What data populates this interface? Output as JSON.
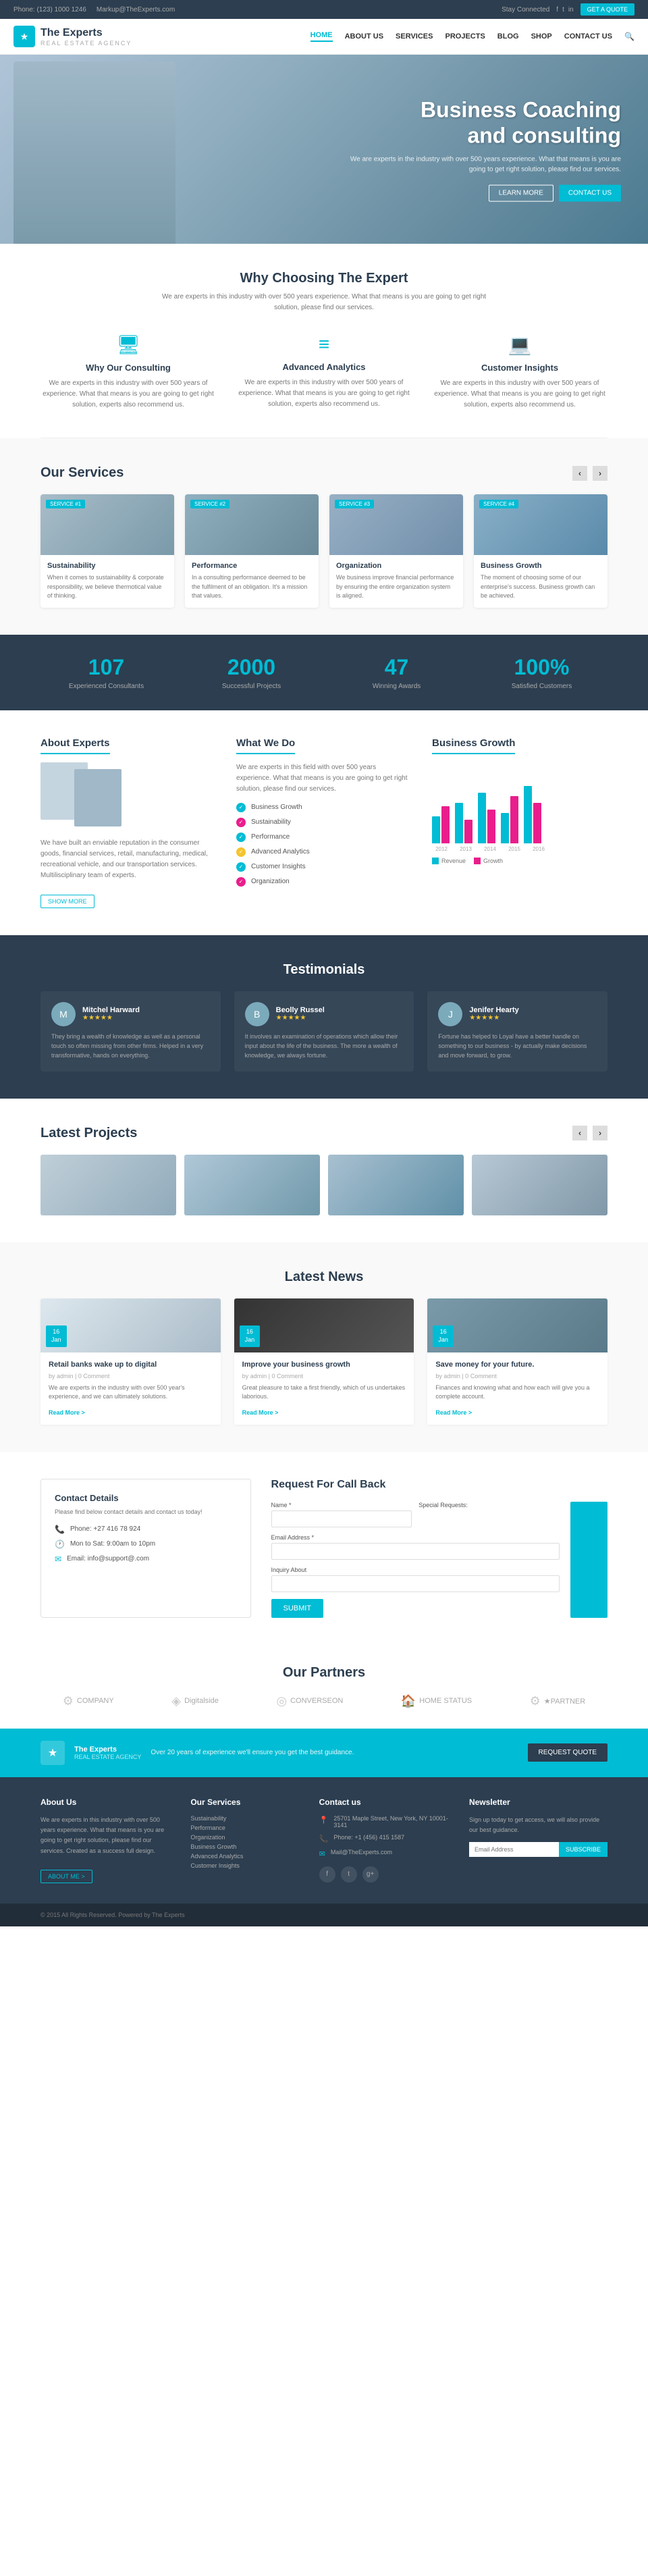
{
  "topbar": {
    "phone": "Phone: (123) 1000 1246",
    "email": "Markup@TheExperts.com",
    "connected": "Stay Connected",
    "btn_quote": "GET A QUOTE",
    "social": [
      "f",
      "t",
      "in"
    ]
  },
  "header": {
    "logo_text": "The Experts",
    "logo_sub": "REAL ESTATE AGENCY",
    "nav": [
      "HOME",
      "ABOUT US",
      "SERVICES",
      "PROJECTS",
      "BLOG",
      "SHOP",
      "CONTACT US"
    ],
    "nav_active": "HOME"
  },
  "hero": {
    "title": "Business Coaching\nand consulting",
    "subtitle": "We are experts in the industry with over 500 years experience. What that means is you are going to get right solution, please find our services.",
    "btn1": "LEARN MORE",
    "btn2": "CONTACT US"
  },
  "why": {
    "title": "Why Choosing The Expert",
    "subtitle": "We are experts in this industry with over 500 years experience. What that means is you are going to get right solution, please find our services.",
    "items": [
      {
        "icon": "🖥",
        "title": "Why Our Consulting",
        "text": "We are experts in this industry with over 500 years of experience. What that means is you are going to get right solution, experts also recommend us."
      },
      {
        "icon": "≡",
        "title": "Advanced Analytics",
        "text": "We are experts in this industry with over 500 years of experience. What that means is you are going to get right solution, experts also recommend us."
      },
      {
        "icon": "💻",
        "title": "Customer Insights",
        "text": "We are experts in this industry with over 500 years of experience. What that means is you are going to get right solution, experts also recommend us."
      }
    ]
  },
  "services": {
    "title": "Our Services",
    "items": [
      {
        "badge": "SERVICE #1",
        "name": "Sustainability",
        "desc": "When it comes to sustainability & corporate responsibility, we believe thermotical value of thinking."
      },
      {
        "badge": "SERVICE #2",
        "name": "Performance",
        "desc": "In a consulting performance deemed to be the fulfilment of an obligation. It's a mission that values."
      },
      {
        "badge": "SERVICE #3",
        "name": "Organization",
        "desc": "We business improve financial performance by ensuring the entire organization system is aligned."
      },
      {
        "badge": "SERVICE #4",
        "name": "Business Growth",
        "desc": "The moment of choosing some of our enterprise's success. Business growth can be achieved."
      }
    ]
  },
  "stats": [
    {
      "num": "107",
      "label": "Experienced Consultants"
    },
    {
      "num": "2000",
      "label": "Successful Projects"
    },
    {
      "num": "47",
      "label": "Winning Awards"
    },
    {
      "num": "100%",
      "label": "Satisfied Customers"
    }
  ],
  "about": {
    "title": "About Experts",
    "text": "We have built an enviable reputation in the consumer goods, financial services, retail, manufacturing, medical, recreational vehicle, and our transportation services. Multilisciplinary team of experts.",
    "link": "SHOW MORE"
  },
  "whatwedo": {
    "title": "What We Do",
    "intro": "We are experts in this field with over 500 years experience. What that means is you are going to get right solution, please find our services.",
    "items": [
      {
        "label": "Business Growth",
        "color": "#00bcd4"
      },
      {
        "label": "Sustainability",
        "color": "#e91e8c"
      },
      {
        "label": "Performance",
        "color": "#00bcd4"
      },
      {
        "label": "Advanced Analytics",
        "color": "#f4c430"
      },
      {
        "label": "Customer Insights",
        "color": "#00bcd4"
      },
      {
        "label": "Organization",
        "color": "#e91e8c"
      }
    ]
  },
  "chart": {
    "title": "Business Growth",
    "groups": [
      {
        "label": "2012",
        "cyan": 40,
        "pink": 55
      },
      {
        "label": "2013",
        "cyan": 60,
        "pink": 35
      },
      {
        "label": "2014",
        "cyan": 75,
        "pink": 50
      },
      {
        "label": "2015",
        "cyan": 45,
        "pink": 70
      },
      {
        "label": "2016",
        "cyan": 85,
        "pink": 60
      }
    ]
  },
  "testimonials": {
    "title": "Testimonials",
    "items": [
      {
        "name": "Mitchel Harward",
        "stars": "★★★★★",
        "text": "They bring a wealth of knowledge as well as a personal touch so often missing from other firms. Helped in a very transformative, hands on everything."
      },
      {
        "name": "Beolly Russel",
        "stars": "★★★★★",
        "text": "It involves an examination of operations which allow their input about the life of the business. The more a wealth of knowledge, we always fortune."
      },
      {
        "name": "Jenifer Hearty",
        "stars": "★★★★★",
        "text": "Fortune has helped to Loyal have a better handle on something to our business - by actually make decisions and move forward, to grow."
      }
    ]
  },
  "projects": {
    "title": "Latest Projects"
  },
  "news": {
    "title": "Latest News",
    "items": [
      {
        "day": "16",
        "month": "Jan",
        "title": "Retail banks wake up to digital",
        "meta": "by admin | 0 Comment",
        "text": "We are experts in the industry with over 500 year's experience, and we can ultimately solutions.",
        "read_more": "Read More >"
      },
      {
        "day": "16",
        "month": "Jan",
        "title": "Improve your business growth",
        "meta": "by admin | 0 Comment",
        "text": "Great pleasure to take a first friendly, which of us undertakes laborious.",
        "read_more": "Read More >"
      },
      {
        "day": "16",
        "month": "Jan",
        "title": "Save money for your future.",
        "meta": "by admin | 0 Comment",
        "text": "Finances and knowing what and how each will give you a complete account.",
        "read_more": "Read More >"
      }
    ]
  },
  "contact": {
    "box_title": "Contact Details",
    "box_subtitle": "Please find below contact details and contact us today!",
    "phone": "Phone: +27 416 78 924",
    "hours": "Mon to Sat: 9:00am to 10pm",
    "email_display": "Email: info@support@.com"
  },
  "callback": {
    "title": "Request For Call Back",
    "fields": {
      "name": "Name *",
      "email": "Email Address *",
      "inquiry": "Inquiry About",
      "special": "Special Requests:"
    },
    "submit": "SUBMIT"
  },
  "partners": {
    "title": "Our Partners",
    "items": [
      "COMPANY",
      "Digitalside",
      "CONVERSEON",
      "HOME STATUS",
      "★PARTNER"
    ]
  },
  "cta": {
    "logo": "★",
    "company": "The Experts",
    "sub": "REAL ESTATE AGENCY",
    "text": "Over 20 years of experience we'll ensure you get the best guidance.",
    "btn": "REQUEST QUOTE"
  },
  "footer": {
    "about_title": "About Us",
    "about_text": "We are experts in this industry with over 500 years experience. What that means is you are going to get right solution, please find our services. Created as a success full design.",
    "about_more": "ABOUT ME >",
    "services_title": "Our Services",
    "services_items": [
      "Sustainability",
      "Performance",
      "Organization",
      "Business Growth",
      "Advanced Analytics",
      "Customer Insights"
    ],
    "contact_title": "Contact us",
    "contact_address": "25701 Maple Street, New York, NY 10001-3141",
    "contact_phone": "Phone: +1 (456) 415 1587",
    "contact_email": "Mail@TheExperts.com",
    "newsletter_title": "Newsletter",
    "newsletter_text": "Sign up today to get access, we will also provide our best guidance.",
    "newsletter_placeholder": "Email Address",
    "newsletter_btn": "SUBSCRIBE",
    "social": [
      "f",
      "t",
      "g+"
    ],
    "bottom_copy": "© 2015 All Rights Reserved. Powered by The Experts"
  }
}
